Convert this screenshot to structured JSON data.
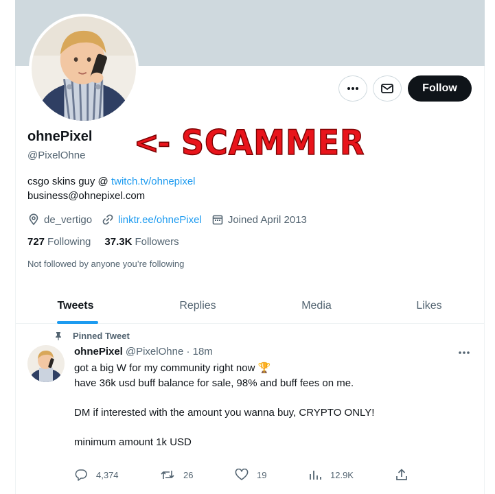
{
  "profile": {
    "display_name": "ohnePixel",
    "handle": "@PixelOhne",
    "bio_text": "csgo skins guy @ ",
    "bio_link": "twitch.tv/ohnepixel",
    "bio_email": "business@ohnepixel.com",
    "location": "de_vertigo",
    "website": "linktr.ee/ohnePixel",
    "joined": "Joined April 2013",
    "following_count": "727",
    "following_label": "Following",
    "followers_count": "37.3K",
    "followers_label": "Followers",
    "not_followed": "Not followed by anyone you’re following"
  },
  "actions": {
    "more_icon": "more-dots-icon",
    "mail_icon": "mail-icon",
    "follow_label": "Follow"
  },
  "annotation": {
    "arrow": "<-",
    "text": "SCAMMER",
    "color": "#e8141b"
  },
  "tabs": [
    {
      "label": "Tweets",
      "active": true
    },
    {
      "label": "Replies",
      "active": false
    },
    {
      "label": "Media",
      "active": false
    },
    {
      "label": "Likes",
      "active": false
    }
  ],
  "tweet": {
    "pinned_label": "Pinned Tweet",
    "author_name": "ohnePixel",
    "author_meta": "@PixelOhne · 18m",
    "line1": "got a big W for my community right now 🏆",
    "line2": "have 36k usd buff balance for sale, 98% and buff fees on me.",
    "line3": "DM if interested with the amount you wanna buy, CRYPTO ONLY!",
    "line4": "minimum amount 1k USD",
    "replies": "4,374",
    "retweets": "26",
    "likes": "19",
    "views": "12.9K"
  },
  "colors": {
    "accent": "#1d9bf0",
    "text": "#0f1419",
    "muted": "#536471",
    "banner": "#cfd9de"
  }
}
